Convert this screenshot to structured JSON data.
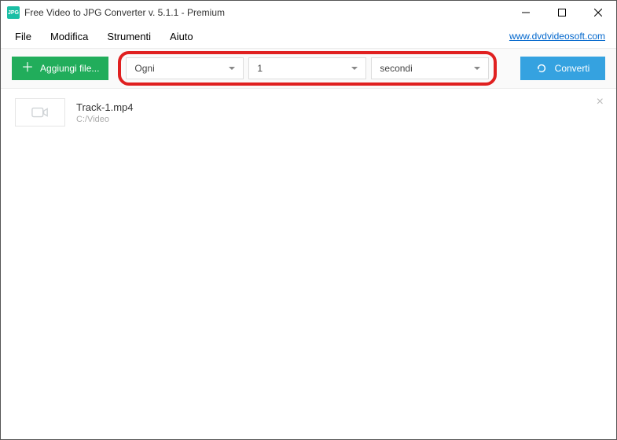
{
  "title": "Free Video to JPG Converter v. 5.1.1 - Premium",
  "app_icon_text": "JPG",
  "menu": {
    "file": "File",
    "edit": "Modifica",
    "tools": "Strumenti",
    "help": "Aiuto"
  },
  "link": "www.dvdvideosoft.com",
  "toolbar": {
    "add_label": "Aggiungi file...",
    "select_mode": "Ogni",
    "select_value": "1",
    "select_unit": "secondi",
    "convert": "Converti"
  },
  "files": [
    {
      "name": "Track-1.mp4",
      "path": "C:/Video"
    }
  ]
}
